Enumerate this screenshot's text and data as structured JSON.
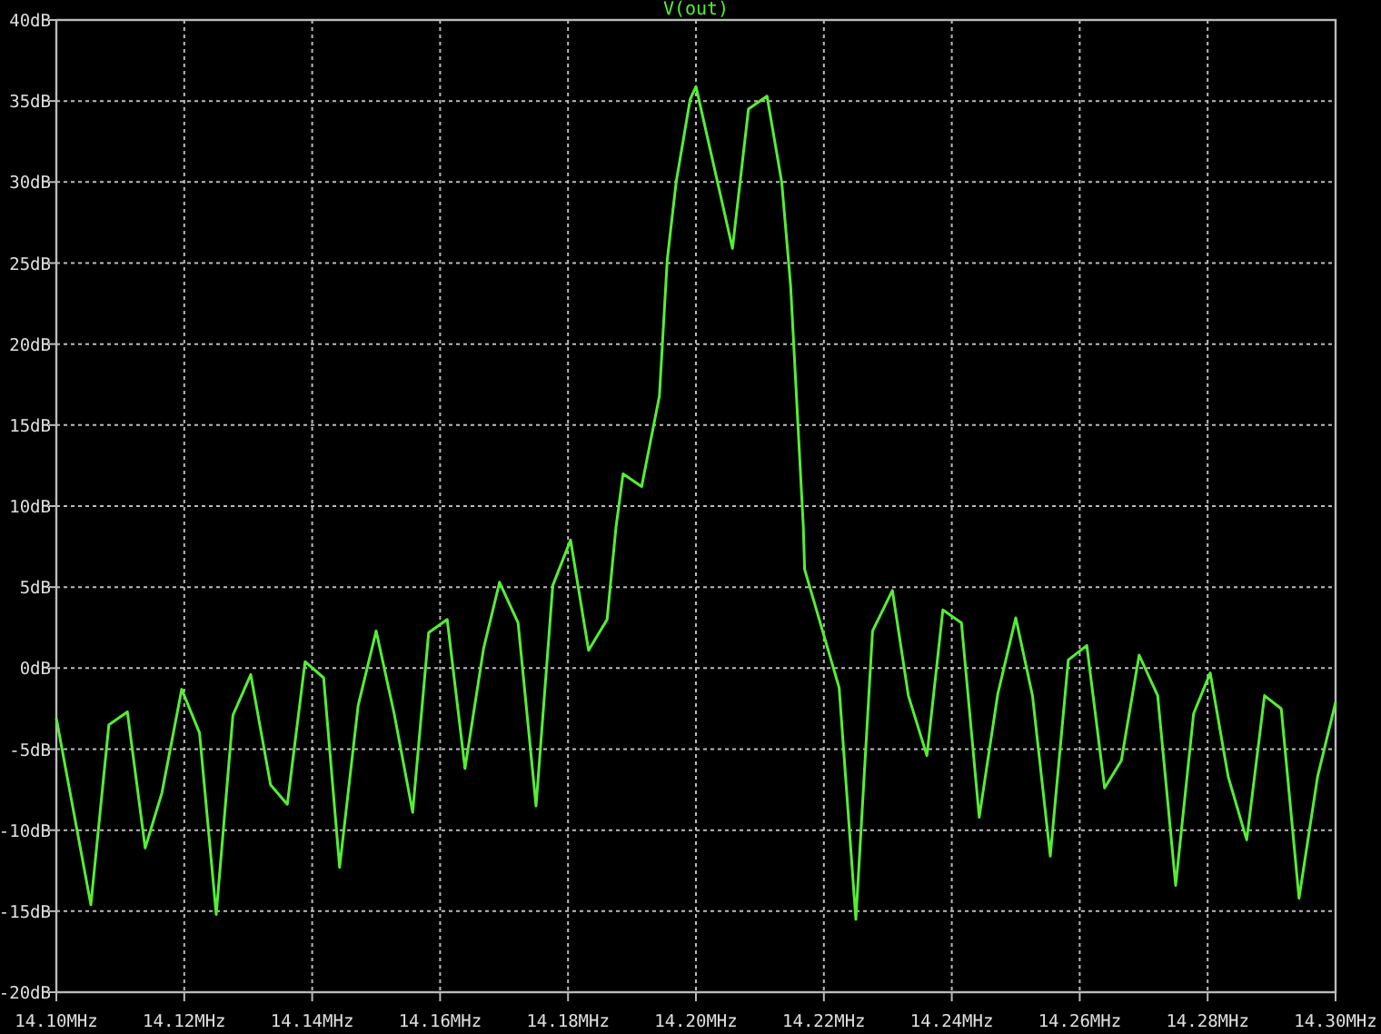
{
  "plot": {
    "chart_data": {
      "type": "line",
      "grid": true,
      "xlim": [
        14.1,
        14.3
      ],
      "ylim": [
        -20,
        40
      ],
      "xticks": [
        {
          "value": 14.1,
          "label": "14.10MHz"
        },
        {
          "value": 14.12,
          "label": "14.12MHz"
        },
        {
          "value": 14.14,
          "label": "14.14MHz"
        },
        {
          "value": 14.16,
          "label": "14.16MHz"
        },
        {
          "value": 14.18,
          "label": "14.18MHz"
        },
        {
          "value": 14.2,
          "label": "14.20MHz"
        },
        {
          "value": 14.22,
          "label": "14.22MHz"
        },
        {
          "value": 14.24,
          "label": "14.24MHz"
        },
        {
          "value": 14.26,
          "label": "14.26MHz"
        },
        {
          "value": 14.28,
          "label": "14.28MHz"
        },
        {
          "value": 14.3,
          "label": "14.30MHz"
        }
      ],
      "yticks": [
        {
          "value": 40,
          "label": "40dB"
        },
        {
          "value": 35,
          "label": "35dB"
        },
        {
          "value": 30,
          "label": "30dB"
        },
        {
          "value": 25,
          "label": "25dB"
        },
        {
          "value": 20,
          "label": "20dB"
        },
        {
          "value": 15,
          "label": "15dB"
        },
        {
          "value": 10,
          "label": "10dB"
        },
        {
          "value": 5,
          "label": "5dB"
        },
        {
          "value": 0,
          "label": "0dB"
        },
        {
          "value": -5,
          "label": "-5dB"
        },
        {
          "value": -10,
          "label": "-10dB"
        },
        {
          "value": -15,
          "label": "-15dB"
        },
        {
          "value": -20,
          "label": "-20dB"
        }
      ],
      "x": [
        14.1,
        14.1054,
        14.1082,
        14.1111,
        14.1139,
        14.1165,
        14.1196,
        14.1224,
        14.125,
        14.1276,
        14.1304,
        14.1335,
        14.1361,
        14.1389,
        14.1418,
        14.1443,
        14.1472,
        14.15,
        14.1528,
        14.1557,
        14.1582,
        14.1611,
        14.1639,
        14.1668,
        14.1693,
        14.1722,
        14.175,
        14.1776,
        14.1804,
        14.1832,
        14.1861,
        14.1875,
        14.1886,
        14.1915,
        14.1943,
        14.1955,
        14.1969,
        14.1991,
        14.2,
        14.2057,
        14.2082,
        14.2111,
        14.2134,
        14.2148,
        14.2168,
        14.217,
        14.2224,
        14.225,
        14.2276,
        14.2307,
        14.2332,
        14.2361,
        14.2386,
        14.2415,
        14.2443,
        14.2472,
        14.25,
        14.2526,
        14.2554,
        14.2582,
        14.2611,
        14.2639,
        14.2665,
        14.2693,
        14.2722,
        14.275,
        14.2778,
        14.2804,
        14.2832,
        14.2861,
        14.2889,
        14.2915,
        14.2943,
        14.2972,
        14.3
      ],
      "series": [
        {
          "name": "V(out)",
          "color": "#55ee33",
          "values": [
            -3.1,
            -14.6,
            -3.5,
            -2.7,
            -11.1,
            -7.7,
            -1.3,
            -4.0,
            -15.2,
            -2.9,
            -0.4,
            -7.2,
            -8.4,
            0.4,
            -0.6,
            -12.3,
            -2.3,
            2.3,
            -2.8,
            -8.9,
            2.2,
            3.0,
            -6.2,
            1.2,
            5.3,
            2.8,
            -8.5,
            5.1,
            7.9,
            1.1,
            3.0,
            8.7,
            12.0,
            11.2,
            16.8,
            25.2,
            30.0,
            35.1,
            35.9,
            25.9,
            34.5,
            35.3,
            30.0,
            23.6,
            8.7,
            6.1,
            -1.2,
            -15.5,
            2.3,
            4.8,
            -1.7,
            -5.4,
            3.6,
            2.8,
            -9.2,
            -1.6,
            3.1,
            -1.7,
            -11.6,
            0.5,
            1.4,
            -7.4,
            -5.7,
            0.8,
            -1.7,
            -13.4,
            -2.8,
            -0.3,
            -6.7,
            -10.6,
            -1.7,
            -2.5,
            -14.2,
            -6.7,
            -2.1
          ]
        }
      ]
    }
  }
}
